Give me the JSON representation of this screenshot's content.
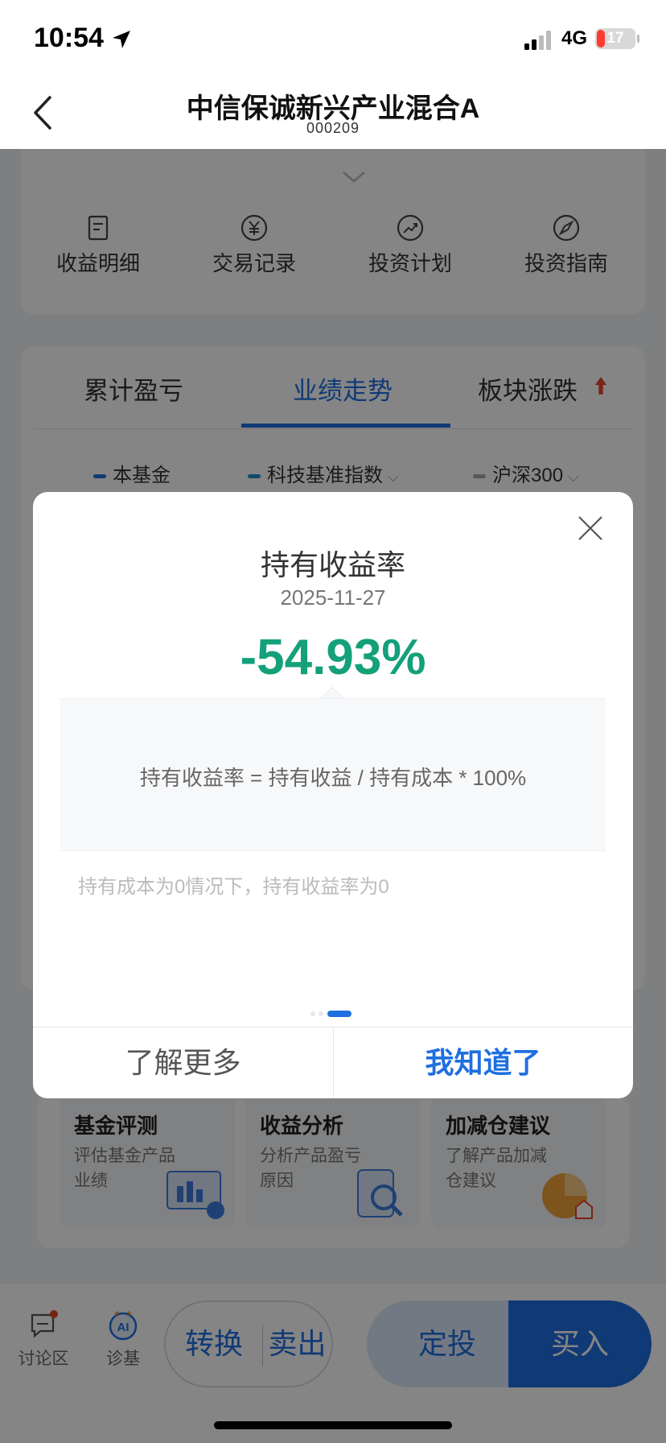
{
  "status_bar": {
    "time": "10:54",
    "network": "4G",
    "battery": "17"
  },
  "nav": {
    "title": "中信保诚新兴产业混合A",
    "code": "000209"
  },
  "quick_actions": [
    {
      "label": "收益明细",
      "icon": "document-icon"
    },
    {
      "label": "交易记录",
      "icon": "yuan-icon"
    },
    {
      "label": "投资计划",
      "icon": "trend-icon"
    },
    {
      "label": "投资指南",
      "icon": "compass-icon"
    }
  ],
  "tabs": [
    {
      "label": "累计盈亏",
      "active": false
    },
    {
      "label": "业绩走势",
      "active": true
    },
    {
      "label": "板块涨跌",
      "active": false
    }
  ],
  "legend": [
    {
      "label": "本基金",
      "color": "#1f6fe0"
    },
    {
      "label": "科技基准指数",
      "color": "#1f8fd0"
    },
    {
      "label": "沪深300",
      "color": "#999999"
    }
  ],
  "features": [
    {
      "title": "基金评测",
      "desc": "评估基金产品业绩"
    },
    {
      "title": "收益分析",
      "desc": "分析产品盈亏原因"
    },
    {
      "title": "加减仓建议",
      "desc": "了解产品加减仓建议"
    }
  ],
  "bottom_bar": {
    "discussion": "讨论区",
    "diagnose": "诊基",
    "convert": "转换",
    "sell": "卖出",
    "auto_invest": "定投",
    "buy": "买入"
  },
  "modal": {
    "title": "持有收益率",
    "date": "2025-11-27",
    "value": "-54.93%",
    "formula": "持有收益率 = 持有收益 / 持有成本 * 100%",
    "note": "持有成本为0情况下，持有收益率为0",
    "learn_more": "了解更多",
    "got_it": "我知道了"
  }
}
